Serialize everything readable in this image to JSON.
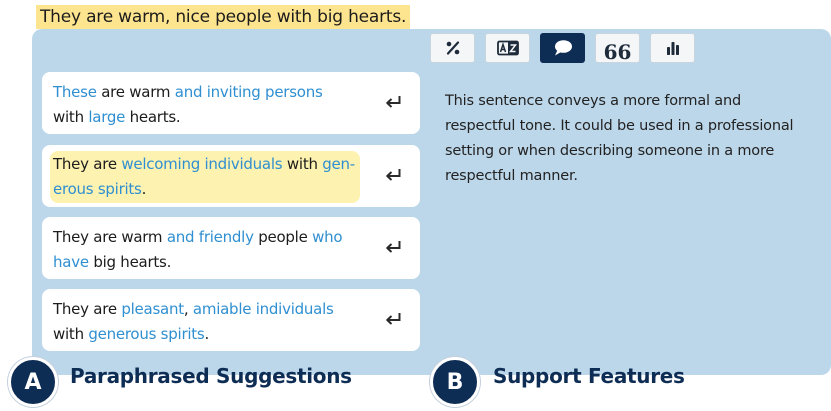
{
  "input_sentence": "They are warm, nice people with big hearts.",
  "toolbar": [
    {
      "name": "percent-button",
      "icon": "percent-icon",
      "active": false
    },
    {
      "name": "translate-button",
      "icon": "a-z-translate-icon",
      "active": false
    },
    {
      "name": "chat-button",
      "icon": "speech-bubble-icon",
      "active": true
    },
    {
      "name": "quote-button",
      "icon": "quote-icon",
      "glyph": "66",
      "active": false
    },
    {
      "name": "stats-button",
      "icon": "bar-chart-icon",
      "active": false
    }
  ],
  "suggestions": [
    {
      "line1": [
        {
          "t": "These",
          "h": true
        },
        {
          "t": " are warm ",
          "h": false
        },
        {
          "t": "and inviting persons",
          "h": true
        }
      ],
      "line2": [
        {
          "t": "with ",
          "h": false
        },
        {
          "t": "large",
          "h": true
        },
        {
          "t": " hearts.",
          "h": false
        }
      ],
      "selected": false
    },
    {
      "line1": [
        {
          "t": "They are ",
          "h": false
        },
        {
          "t": "welcoming individuals",
          "h": true
        },
        {
          "t": " with ",
          "h": false
        },
        {
          "t": "gen-",
          "h": true
        }
      ],
      "line2": [
        {
          "t": "erous spirits",
          "h": true
        },
        {
          "t": ".",
          "h": false
        }
      ],
      "selected": true
    },
    {
      "line1": [
        {
          "t": "They are warm ",
          "h": false
        },
        {
          "t": "and friendly",
          "h": true
        },
        {
          "t": " people ",
          "h": false
        },
        {
          "t": "who",
          "h": true
        }
      ],
      "line2": [
        {
          "t": "have",
          "h": true
        },
        {
          "t": " big hearts.",
          "h": false
        }
      ],
      "selected": false
    },
    {
      "line1": [
        {
          "t": "They are ",
          "h": false
        },
        {
          "t": "pleasant",
          "h": true
        },
        {
          "t": ", ",
          "h": false
        },
        {
          "t": "amiable individuals",
          "h": true
        }
      ],
      "line2": [
        {
          "t": "with ",
          "h": false
        },
        {
          "t": "generous spirits",
          "h": true
        },
        {
          "t": ".",
          "h": false
        }
      ],
      "selected": false
    }
  ],
  "explanation": "This sentence conveys a more formal and respectful tone. It could be used in a professional setting or when describing someone in a more respectful manner.",
  "sections": {
    "a_badge": "A",
    "a_label": "Paraphrased Suggestions",
    "b_badge": "B",
    "b_label": "Support Features"
  },
  "colors": {
    "highlight_text": "#2f8fd1",
    "panel": "#bdd7ea",
    "navy": "#0e2d55",
    "input_highlight": "#fde48f",
    "selected_highlight": "#fdf2b0"
  }
}
